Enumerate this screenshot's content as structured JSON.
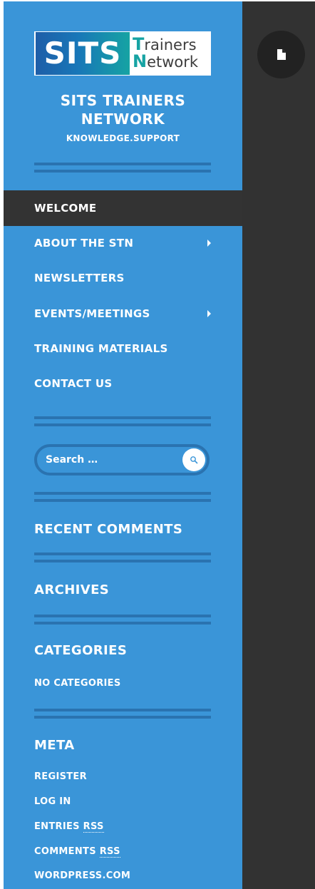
{
  "colors": {
    "accent": "#3a95d8",
    "accent_dark": "#2a73b0",
    "dark": "#323232",
    "active_nav": "#333333"
  },
  "brand": {
    "logo_main": "SITS",
    "logo_line1": "Trainers",
    "logo_line2": "Network",
    "site_title": "SITS TRAINERS NETWORK",
    "tagline": "KNOWLEDGE.SUPPORT"
  },
  "nav": {
    "items": [
      {
        "label": "WELCOME",
        "active": true,
        "has_submenu": false
      },
      {
        "label": "ABOUT THE STN",
        "active": false,
        "has_submenu": true
      },
      {
        "label": "NEWSLETTERS",
        "active": false,
        "has_submenu": false
      },
      {
        "label": "EVENTS/MEETINGS",
        "active": false,
        "has_submenu": true
      },
      {
        "label": "TRAINING MATERIALS",
        "active": false,
        "has_submenu": false
      },
      {
        "label": "CONTACT US",
        "active": false,
        "has_submenu": false
      }
    ]
  },
  "search": {
    "placeholder": "Search …",
    "icon": "search-icon"
  },
  "widgets": {
    "recent_comments": {
      "title": "RECENT COMMENTS"
    },
    "archives": {
      "title": "ARCHIVES"
    },
    "categories": {
      "title": "CATEGORIES",
      "empty_text": "NO CATEGORIES"
    },
    "meta": {
      "title": "META",
      "links": [
        {
          "text": "REGISTER"
        },
        {
          "text": "LOG IN"
        },
        {
          "text": "ENTRIES ",
          "abbr": "RSS"
        },
        {
          "text": "COMMENTS ",
          "abbr": "RSS"
        },
        {
          "text": "WORDPRESS.COM"
        }
      ]
    }
  },
  "post_format_icon": "document-icon"
}
